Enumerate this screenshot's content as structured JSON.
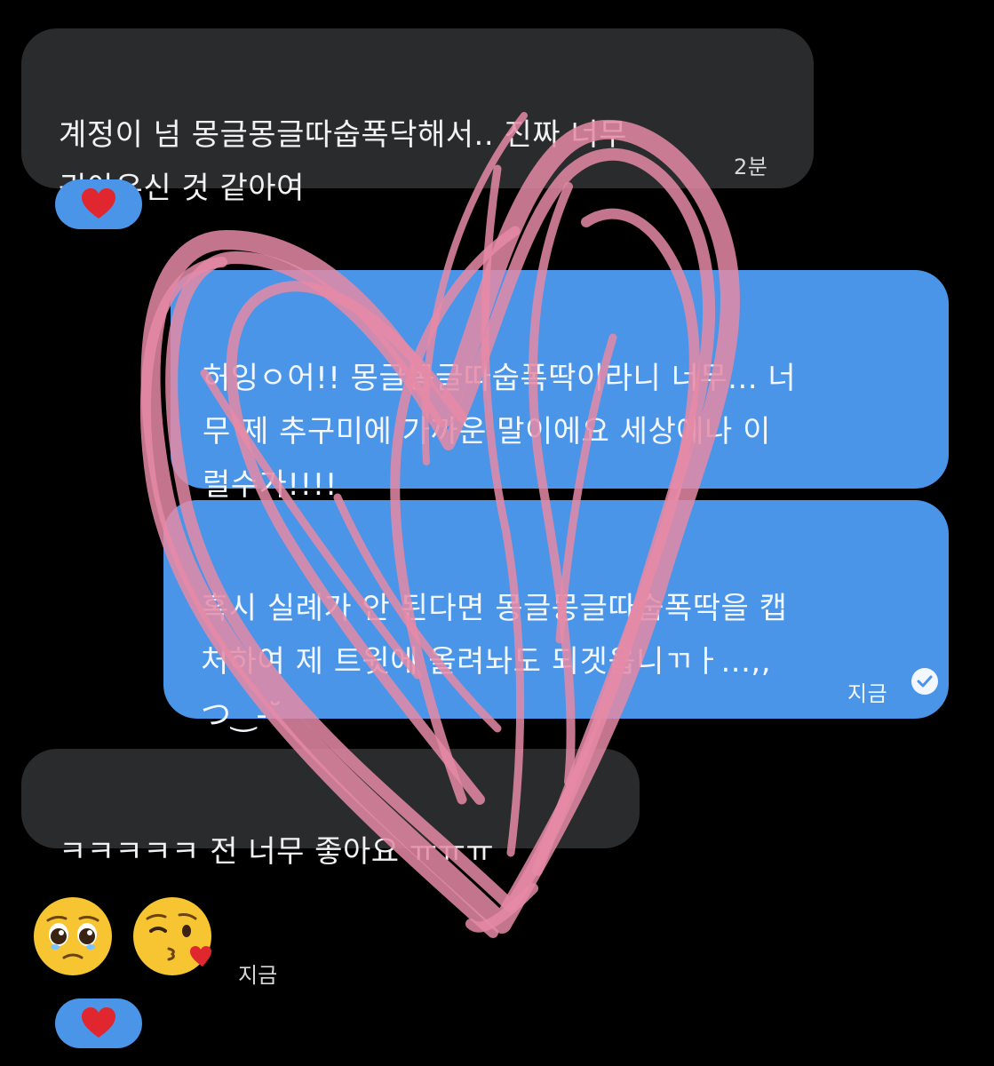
{
  "messages": [
    {
      "text": "계정이 넘 몽글몽글따숩폭닥해서.. 진짜 너무\n귀야우신 것 같아여",
      "time": "2분",
      "reaction": "heart"
    },
    {
      "text": "허잉ㅇ어!! 몽글몽글따숩폭딱이라니 너무... 너\n무 제 추구미에 가까운 말이에요 세상에나 이\n럴수가!!!!"
    },
    {
      "text": "혹시 실례가 안 된다면 몽글몽글따숩폭딱을 캡\n처하여 제 트윗에 올려놔도 되겟읍니ㄲㅏ...,,\nつ‿-˘",
      "time": "지금",
      "status": "read-check-icon"
    },
    {
      "text": "ㅋㅋㅋㅋㅋ 전 너무 좋아요 ㅠㅠㅠ"
    },
    {
      "emojis": [
        "pleading-face",
        "face-blowing-kiss"
      ],
      "time": "지금",
      "reaction": "heart"
    }
  ],
  "colors": {
    "background": "#000000",
    "incoming": "#2a2b2d",
    "outgoing": "#4a95e8",
    "scribble": "#e58aa6"
  }
}
